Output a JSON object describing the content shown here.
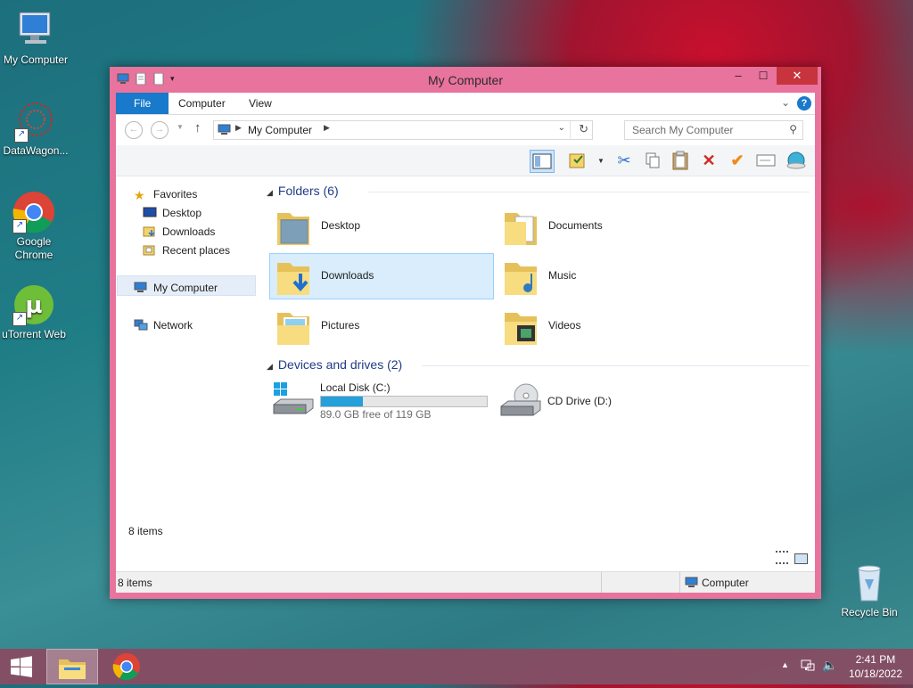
{
  "desktop": {
    "icons": [
      {
        "label": "My Computer"
      },
      {
        "label": "DataWagon..."
      },
      {
        "label": "Google Chrome"
      },
      {
        "label": "uTorrent Web"
      },
      {
        "label": "Recycle Bin"
      }
    ]
  },
  "window": {
    "title": "My Computer",
    "controls": {
      "minimize": "–",
      "maximize": "☐",
      "close": "✕"
    },
    "ribbon_tabs": [
      {
        "label": "File"
      },
      {
        "label": "Computer"
      },
      {
        "label": "View"
      }
    ],
    "help": "?",
    "address": {
      "location": "My Computer"
    },
    "search": {
      "placeholder": "Search My Computer"
    },
    "nav_pane": {
      "favorites": "Favorites",
      "favorite_items": [
        {
          "label": "Desktop"
        },
        {
          "label": "Downloads"
        },
        {
          "label": "Recent places"
        }
      ],
      "computer": "My Computer",
      "network": "Network"
    },
    "folders_header": "Folders (6)",
    "folders": [
      {
        "name": "Desktop"
      },
      {
        "name": "Documents"
      },
      {
        "name": "Downloads"
      },
      {
        "name": "Music"
      },
      {
        "name": "Pictures"
      },
      {
        "name": "Videos"
      }
    ],
    "selected_folder": "Downloads",
    "drives_header": "Devices and drives (2)",
    "drives": [
      {
        "name": "Local Disk (C:)",
        "free_text": "89.0 GB free of 119 GB",
        "used_fraction": 0.25
      },
      {
        "name": "CD Drive (D:)"
      }
    ],
    "inner_count": "8 items",
    "status": {
      "count": "8 items",
      "location": "Computer"
    }
  },
  "taskbar": {
    "time": "2:41 PM",
    "date": "10/18/2022"
  },
  "colors": {
    "accent": "#1979ca",
    "window_frame": "#e8739c",
    "selection": "#d9edfc",
    "taskbar": "#8a4a61"
  }
}
